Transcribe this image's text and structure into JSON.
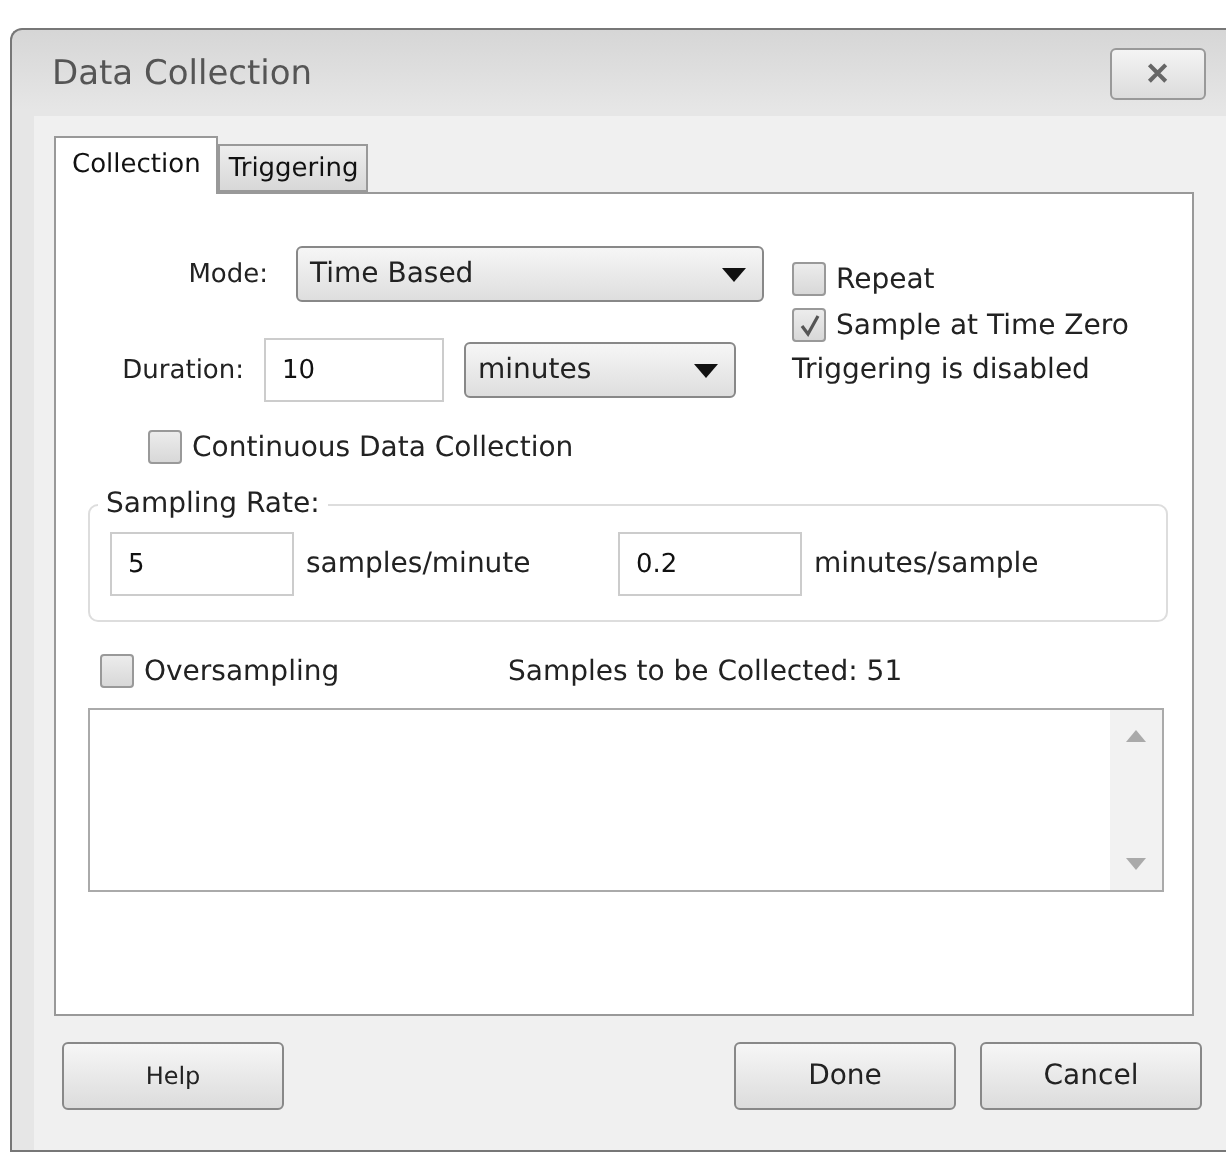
{
  "window": {
    "title": "Data Collection",
    "close": "✕"
  },
  "tabs": [
    {
      "label": "Collection",
      "selected": true
    },
    {
      "label": "Triggering",
      "selected": false
    }
  ],
  "mode": {
    "label": "Mode:",
    "value": "Time Based"
  },
  "duration": {
    "label": "Duration:",
    "value": "10",
    "unit": "minutes"
  },
  "options": [
    {
      "label": "Repeat",
      "checked": false
    },
    {
      "label": "Sample at Time Zero",
      "checked": true
    }
  ],
  "triggering_note": "Triggering is disabled",
  "continuous": {
    "label": "Continuous Data Collection",
    "checked": false
  },
  "sampling_rate": {
    "legend": "Sampling Rate:",
    "samples_per_minute": "5",
    "samples_unit": "samples/minute",
    "minutes_per_sample": "0.2",
    "minutes_unit": "minutes/sample"
  },
  "oversampling": {
    "label": "Oversampling",
    "checked": false
  },
  "samples_to_collect": {
    "label": "Samples to be Collected:",
    "value": "51"
  },
  "buttons": [
    {
      "label": "Help"
    },
    {
      "label": "Done"
    },
    {
      "label": "Cancel"
    }
  ]
}
